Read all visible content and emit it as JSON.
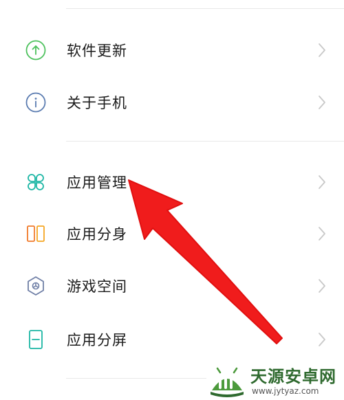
{
  "menu": {
    "group1": [
      {
        "id": "software-update",
        "label": "软件更新",
        "icon": "arrow-up-circle-icon",
        "color": "#4cc15c"
      },
      {
        "id": "about-phone",
        "label": "关于手机",
        "icon": "info-circle-icon",
        "color": "#5a7bb0"
      }
    ],
    "group2": [
      {
        "id": "app-management",
        "label": "应用管理",
        "icon": "app-grid-icon",
        "color": "#1cb6a4"
      },
      {
        "id": "app-clone",
        "label": "应用分身",
        "icon": "dual-app-icon",
        "color": "#f07a2a"
      },
      {
        "id": "game-space",
        "label": "游戏空间",
        "icon": "game-hexagon-icon",
        "color": "#6f7fa6"
      },
      {
        "id": "split-screen",
        "label": "应用分屏",
        "icon": "split-screen-icon",
        "color": "#1cb6a4"
      }
    ]
  },
  "chevron_color": "#c8c8c8",
  "arrow_color": "#f01c1c",
  "watermark": {
    "title": "天源安卓网",
    "url": "www.jytyaz.com",
    "brand_color": "#2f6a2f"
  }
}
